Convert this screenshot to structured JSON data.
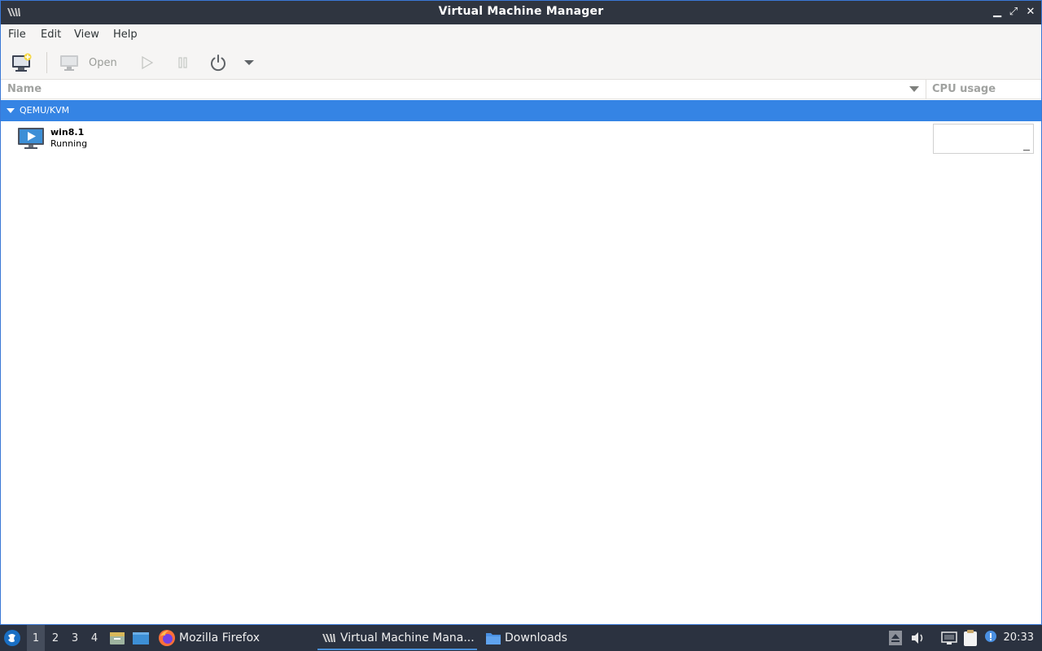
{
  "window": {
    "title": "Virtual Machine Manager",
    "controls": {
      "minimize": "▁",
      "maximize": "⤢",
      "close": "✕"
    }
  },
  "menu": [
    "File",
    "Edit",
    "View",
    "Help"
  ],
  "toolbar": {
    "new_vm_icon": "new-vm-icon",
    "open_label": "Open",
    "run_icon": "play-icon",
    "pause_icon": "pause-icon",
    "shutdown_icon": "power-icon",
    "shutdown_menu_icon": "chevron-down-icon"
  },
  "columns": {
    "name": "Name",
    "cpu": "CPU usage"
  },
  "connection": {
    "label": "QEMU/KVM",
    "expanded": true
  },
  "vms": [
    {
      "name": "win8.1",
      "status": "Running",
      "cpu_usage": 0
    }
  ],
  "taskbar": {
    "desktops": [
      "1",
      "2",
      "3",
      "4"
    ],
    "active_desktop": "1",
    "tasks": [
      {
        "label": "Mozilla Firefox",
        "icon": "firefox-icon"
      },
      {
        "label": "Virtual Machine Mana...",
        "icon": "virt-manager-icon",
        "active": true
      },
      {
        "label": "Downloads",
        "icon": "folder-icon"
      }
    ],
    "clock": "20:33"
  },
  "colors": {
    "titlebar": "#2f3540",
    "selection": "#3584e4",
    "taskbar": "#2b3240",
    "window_border": "#3a78d6"
  }
}
